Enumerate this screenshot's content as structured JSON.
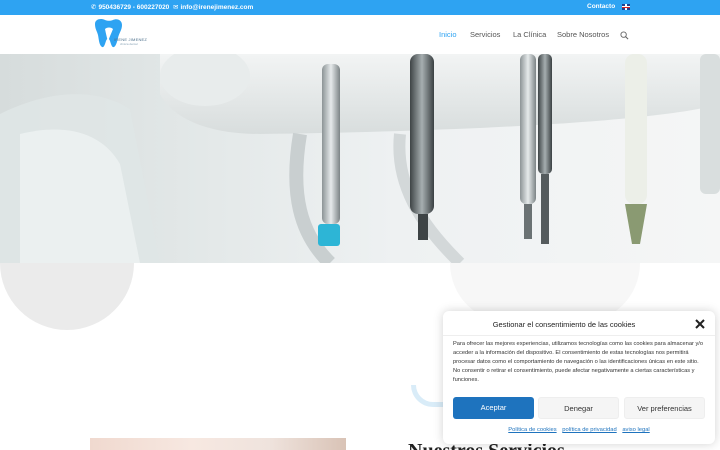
{
  "topbar": {
    "phone": "950436729 - 600227020",
    "email": "info@irenejimenez.com",
    "contact_link": "Contacto",
    "language_flag": "uk-flag-icon",
    "bg_color": "#2ea3f2"
  },
  "header": {
    "logo_name": "IRENE JIMENEZ",
    "logo_tagline": "clínica dental",
    "nav": [
      {
        "label": "Inicio",
        "active": true
      },
      {
        "label": "Servicios",
        "active": false
      },
      {
        "label": "La Clínica",
        "active": false
      },
      {
        "label": "Sobre Nosotros",
        "active": false
      }
    ],
    "search_icon": "search-icon",
    "accent_color": "#2ea3f2"
  },
  "hero": {
    "image": "dental-instruments-photo"
  },
  "section": {
    "heading": "Nuestros Servicios"
  },
  "cookie_banner": {
    "title": "Gestionar el consentimiento de las cookies",
    "body": "Para ofrecer las mejores experiencias, utilizamos tecnologías como las cookies para almacenar y/o acceder a la información del dispositivo. El consentimiento de estas tecnologías nos permitirá procesar datos como el comportamiento de navegación o las identificaciones únicas en este sitio. No consentir o retirar el consentimiento, puede afectar negativamente a ciertas características y funciones.",
    "accept_label": "Aceptar",
    "deny_label": "Denegar",
    "preferences_label": "Ver preferencias",
    "links": [
      "Política de cookies",
      "política de privacidad",
      "aviso legal"
    ],
    "accept_color": "#1e73be"
  }
}
